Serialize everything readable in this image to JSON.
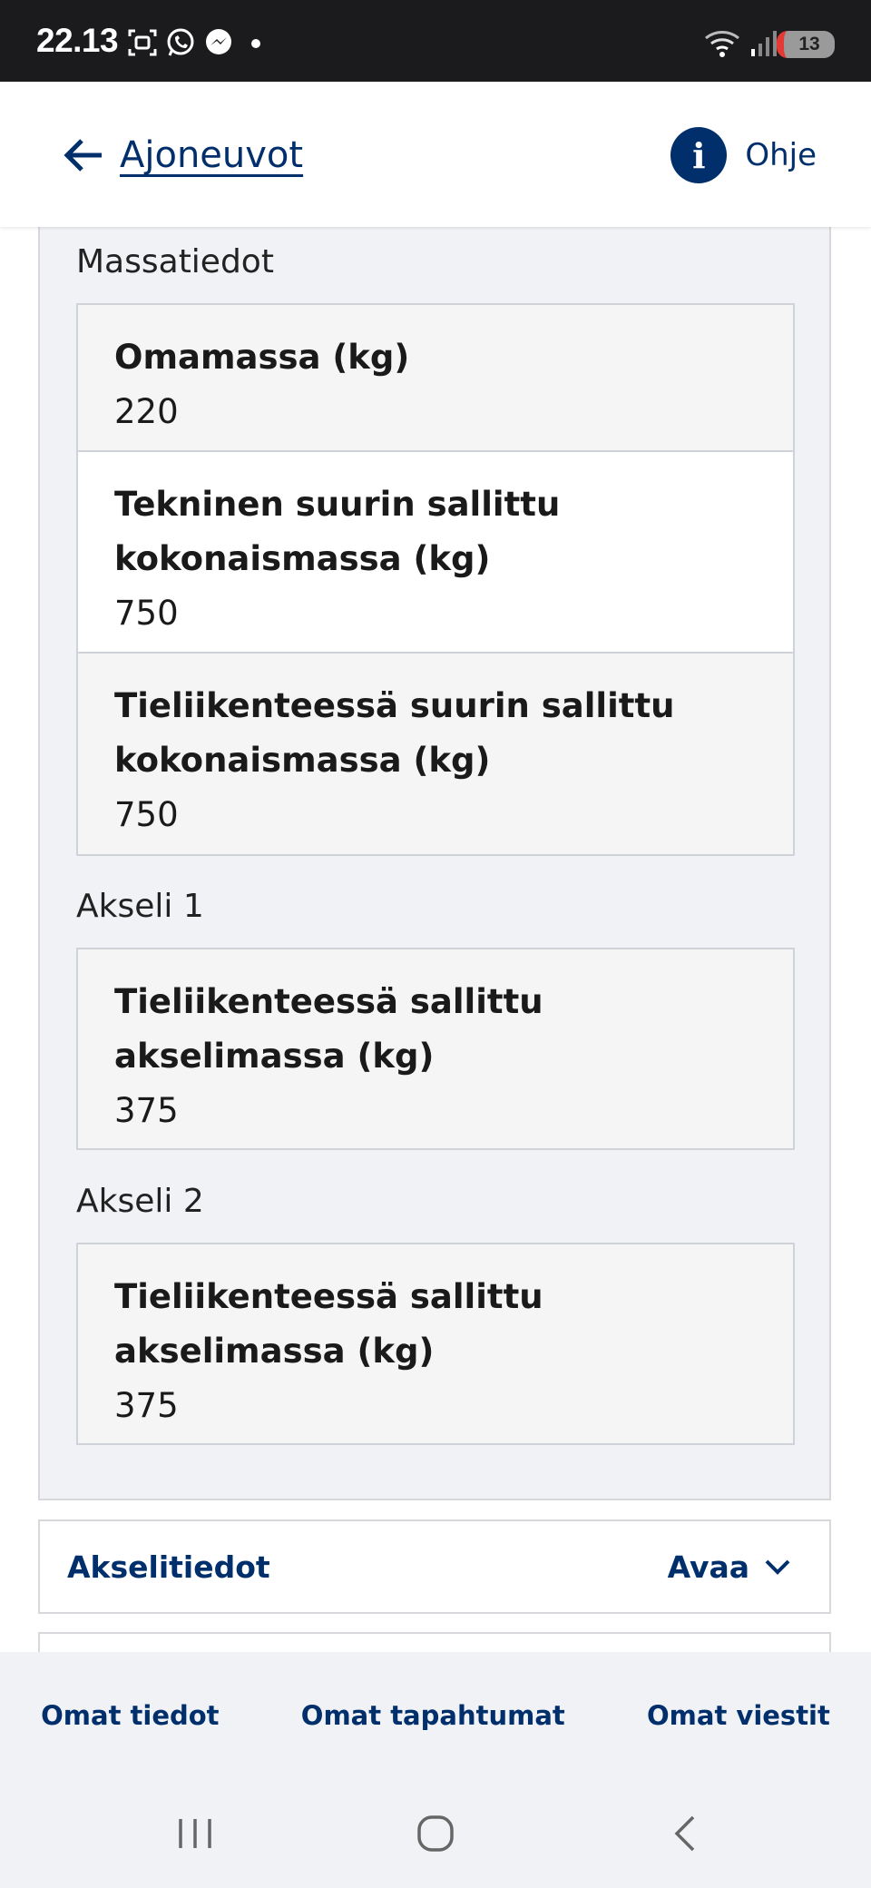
{
  "status_bar": {
    "time": "22.13",
    "battery": "13",
    "colors": {
      "background": "#1b1b1d",
      "battery_low": "#e53935"
    }
  },
  "header": {
    "back_label": "Ajoneuvot",
    "help_label": "Ohje",
    "help_icon_glyph": "i"
  },
  "mass_section": {
    "title": "Massatiedot",
    "rows": [
      {
        "label": "Omamassa (kg)",
        "value": "220"
      },
      {
        "label": "Tekninen suurin sallittu kokonaismassa (kg)",
        "value": "750"
      },
      {
        "label": "Tieliikenteessä suurin sallittu kokonaismassa (kg)",
        "value": "750"
      }
    ]
  },
  "axles": [
    {
      "title": "Akseli 1",
      "label": "Tieliikenteessä sallittu akselimassa (kg)",
      "value": "375"
    },
    {
      "title": "Akseli 2",
      "label": "Tieliikenteessä sallittu akselimassa (kg)",
      "value": "375"
    }
  ],
  "accordion": {
    "title": "Akselitiedot",
    "toggle_label": "Avaa"
  },
  "bottom_nav": {
    "items": [
      "Omat tiedot",
      "Omat tapahtumat",
      "Omat viestit"
    ]
  },
  "theme": {
    "primary": "#002f6c",
    "panel_bg": "#f1f2f5",
    "card_border": "#cfd2d6"
  }
}
